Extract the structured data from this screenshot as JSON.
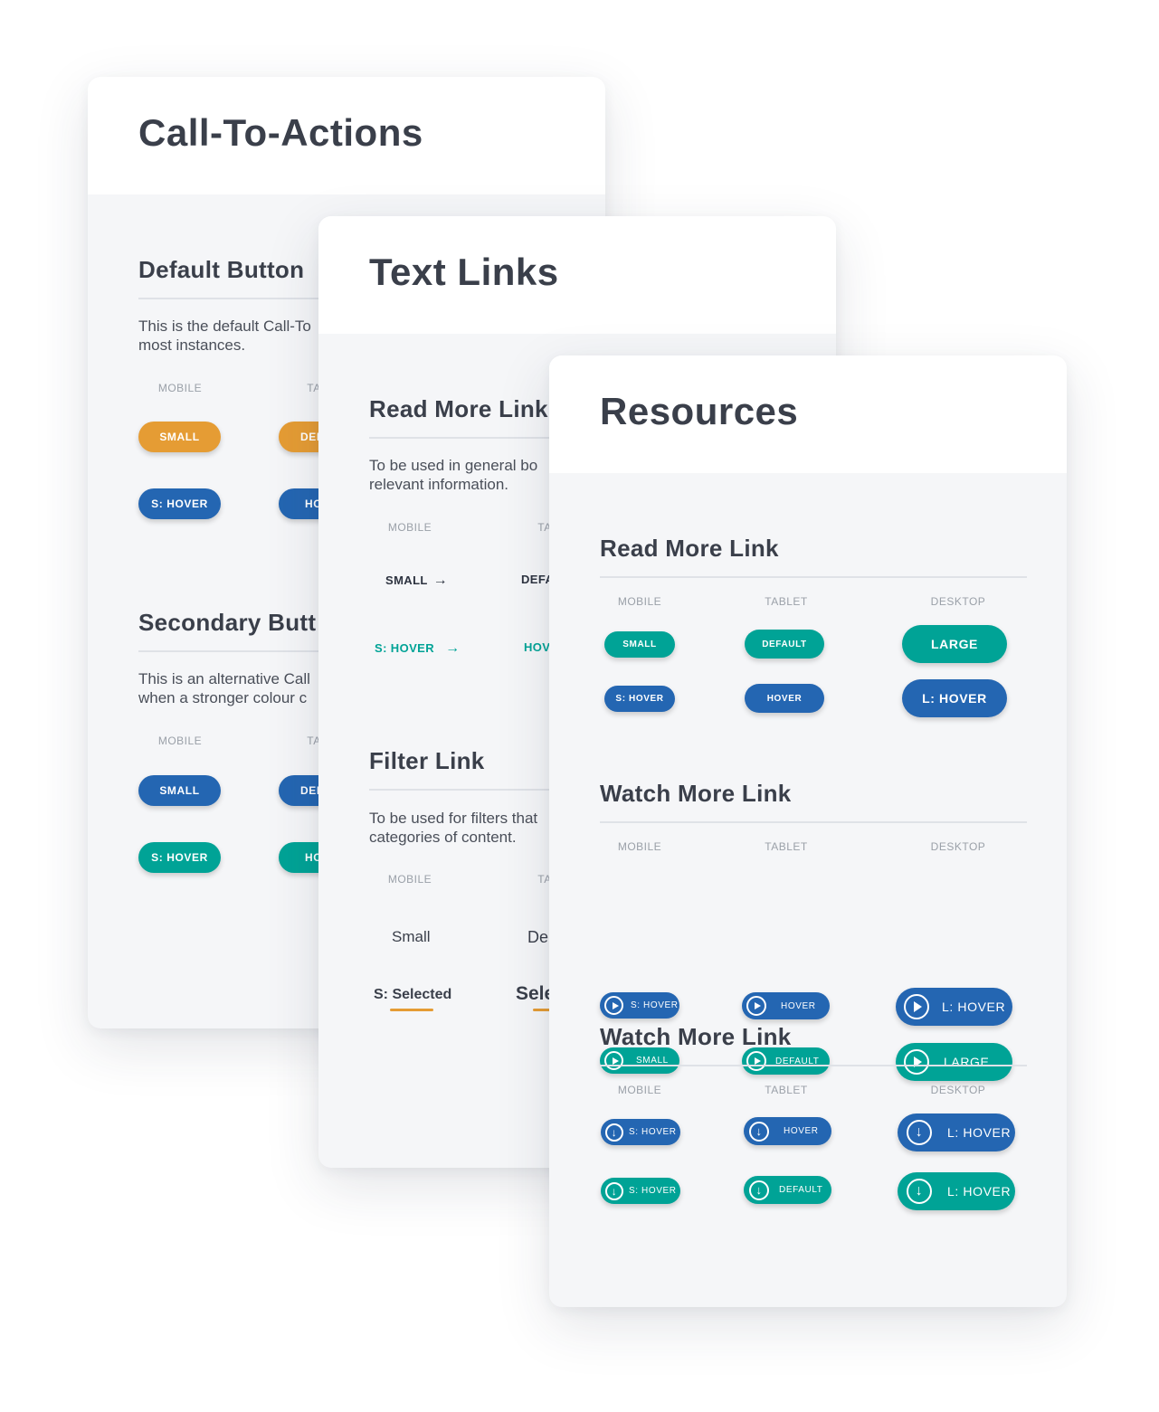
{
  "cta_card": {
    "title": "Call-To-Actions",
    "default_section": {
      "title": "Default Button",
      "description_line1": "This is the default Call-To",
      "description_line2": "most instances.",
      "col_mobile": "MOBILE",
      "col_tablet": "TA",
      "small": "SMALL",
      "default_partial": "DEF",
      "s_hover": "S: HOVER",
      "hover_partial": "HO"
    },
    "secondary_section": {
      "title": "Secondary Butt",
      "description_line1": "This is an alternative Call",
      "description_line2": "when a stronger colour c",
      "col_mobile": "MOBILE",
      "col_tablet": "TA",
      "small": "SMALL",
      "default_partial": "DEF",
      "s_hover": "S: HOVER",
      "hover_partial": "HO"
    }
  },
  "text_links_card": {
    "title": "Text Links",
    "read_more": {
      "title": "Read More Link",
      "description_line1": "To be used in general bo",
      "description_line2": "relevant information.",
      "col_mobile": "MOBILE",
      "col_tablet": "TA",
      "small": "SMALL",
      "default_partial": "DEFA",
      "s_hover": "S: HOVER",
      "hover_partial": "HOV",
      "arrow": "→"
    },
    "filter": {
      "title": "Filter Link",
      "description_line1": "To be used for filters that",
      "description_line2": "categories of content.",
      "col_mobile": "MOBILE",
      "col_tablet": "TA",
      "small": "Small",
      "default_partial": "De",
      "s_selected": "S: Selected",
      "selected_partial": "Sele"
    }
  },
  "resources_card": {
    "title": "Resources",
    "read_more": {
      "title": "Read More Link",
      "cols": [
        "MOBILE",
        "TABLET",
        "DESKTOP"
      ],
      "row1": [
        "SMALL",
        "DEFAULT",
        "LARGE"
      ],
      "row2": [
        "S: HOVER",
        "HOVER",
        "L: HOVER"
      ]
    },
    "watch_more": {
      "title": "Watch More Link",
      "cols": [
        "MOBILE",
        "TABLET",
        "DESKTOP"
      ],
      "row1": [
        "S: HOVER",
        "HOVER",
        "L: HOVER"
      ],
      "row2": [
        "SMALL",
        "DEFAULT",
        "LARGE"
      ]
    },
    "watch_more_download": {
      "title": "Watch More Link",
      "cols": [
        "MOBILE",
        "TABLET",
        "DESKTOP"
      ],
      "row1": [
        "S: HOVER",
        "HOVER",
        "L: HOVER"
      ],
      "row2": [
        "S: HOVER",
        "DEFAULT",
        "L: HOVER"
      ]
    }
  },
  "colors": {
    "orange": "#e59c34",
    "blue": "#2466b2",
    "teal": "#00a396",
    "heading": "#3a3f4a",
    "card_bg": "#f5f6f8"
  },
  "icons": {
    "play": "play-circle-icon",
    "download": "download-circle-icon",
    "arrow": "arrow-right-icon"
  }
}
